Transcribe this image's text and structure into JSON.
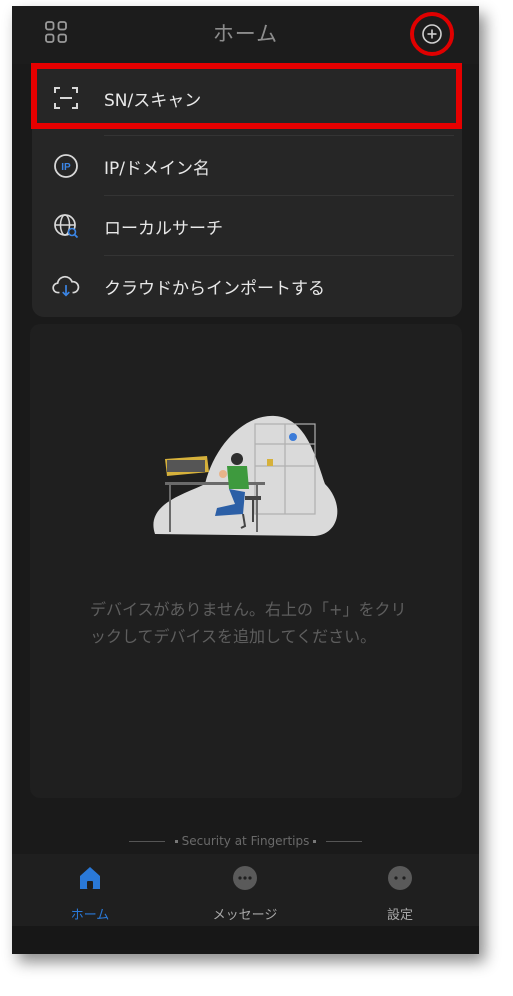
{
  "header": {
    "title": "ホーム"
  },
  "menu": {
    "items": [
      {
        "label": "SN/スキャン",
        "icon": "scan-icon"
      },
      {
        "label": "IP/ドメイン名",
        "icon": "ip-icon"
      },
      {
        "label": "ローカルサーチ",
        "icon": "globe-search-icon"
      },
      {
        "label": "クラウドからインポートする",
        "icon": "cloud-import-icon"
      }
    ]
  },
  "empty_state": {
    "message": "デバイスがありません。右上の「+」をクリックしてデバイスを追加してください。"
  },
  "footer": {
    "slogan": "Security at Fingertips"
  },
  "tabs": [
    {
      "label": "ホーム",
      "icon": "home-icon",
      "active": true
    },
    {
      "label": "メッセージ",
      "icon": "message-icon",
      "active": false
    },
    {
      "label": "設定",
      "icon": "settings-icon",
      "active": false
    }
  ],
  "colors": {
    "accent": "#2a79d8",
    "highlight": "#e60000"
  }
}
